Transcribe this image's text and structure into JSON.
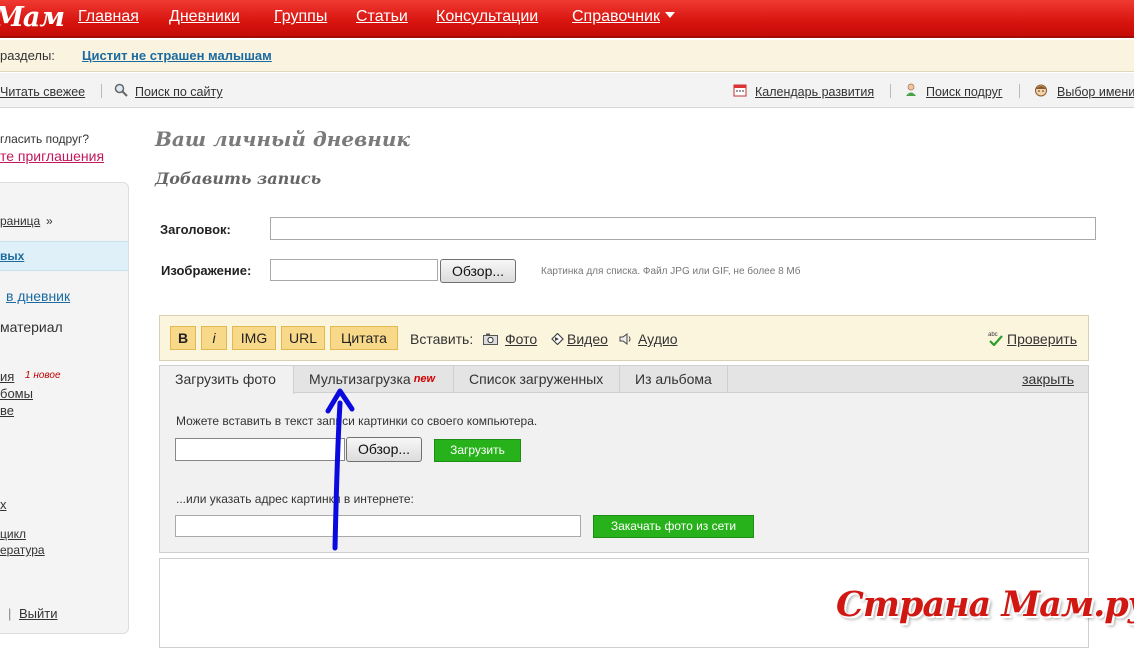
{
  "top_nav": {
    "logo": "Мам",
    "items": [
      "Главная",
      "Дневники",
      "Группы",
      "Статьи",
      "Консультации",
      "Справочник"
    ]
  },
  "sections_bar": {
    "label": "разделы:",
    "link": "Цистит не страшен малышам"
  },
  "toolbar": {
    "read_fresh": "Читать свежее",
    "site_search": "Поиск по сайту",
    "dev_calendar": "Календарь развития",
    "find_friends": "Поиск подруг",
    "name_choice": "Выбор имени"
  },
  "sidebar": {
    "invite_q": "гласить подруг?",
    "invite_link": "те приглашения",
    "page_link": "раница",
    "page_arrow": "»",
    "active_item": "вых",
    "in_diary": "в дневник",
    "material": "материал",
    "item_a": "ия",
    "item_a_badge": "1 новое",
    "item_b": "бомы",
    "item_c": "ве",
    "item_d": "х",
    "item_e": "цикл",
    "item_f": "ература",
    "logout_sep": "|",
    "logout": "Выйти"
  },
  "main": {
    "title": "Ваш личный дневник",
    "subtitle": "Добавить запись"
  },
  "form": {
    "heading_label": "Заголовок:",
    "image_label": "Изображение:",
    "browse_label": "Обзор...",
    "image_hint": "Картинка для списка. Файл JPG или GIF, не более 8 Мб"
  },
  "editor": {
    "bold": "B",
    "italic": "i",
    "img": "IMG",
    "url": "URL",
    "quote": "Цитата",
    "insert_label": "Вставить:",
    "photo": "Фото",
    "video": "Видео",
    "audio": "Аудио",
    "spellcheck": "Проверить"
  },
  "upload_panel": {
    "tabs": [
      "Загрузить фото",
      "Мультизагрузка",
      "Список загруженных",
      "Из альбома"
    ],
    "new_badge": "new",
    "close": "закрыть",
    "local_hint": "Можете вставить в текст записи картинки со своего компьютера.",
    "browse_label": "Обзор...",
    "upload_button": "Загрузить",
    "url_hint": "...или указать адрес картинки в интернете:",
    "fetch_button": "Закачать фото из сети"
  },
  "watermark": "Страна Мам.ру",
  "colors": {
    "nav_red": "#d8140f",
    "link_blue": "#1b6aa0",
    "green_button": "#27b21b",
    "annotation_arrow": "#0a0adf"
  }
}
